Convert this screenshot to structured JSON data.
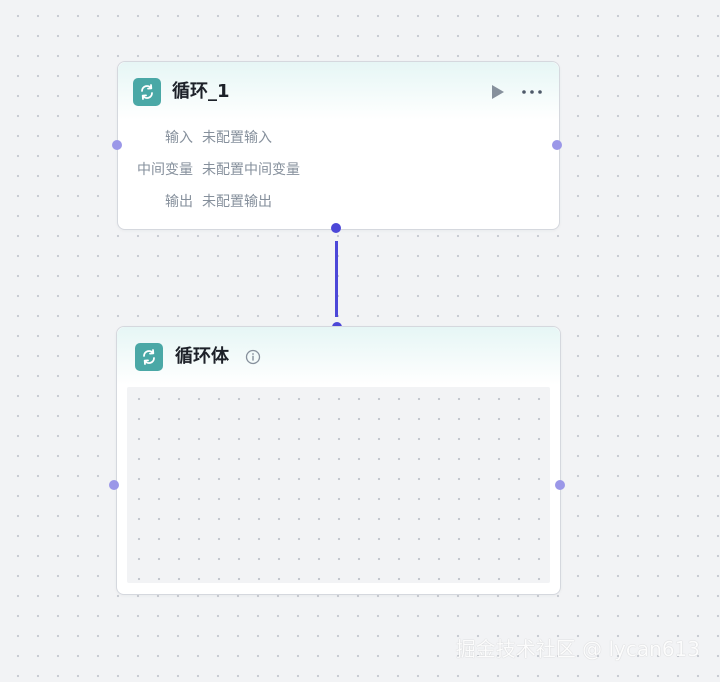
{
  "loop_node": {
    "icon": "loop-icon",
    "title": "循环_1",
    "run_icon": "play-icon",
    "more_icon": "more-horizontal-icon",
    "rows": [
      {
        "label": "输入",
        "value": "未配置输入"
      },
      {
        "label": "中间变量",
        "value": "未配置中间变量"
      },
      {
        "label": "输出",
        "value": "未配置输出"
      }
    ]
  },
  "loop_body_node": {
    "icon": "loop-icon",
    "title": "循环体",
    "info_icon": "info-icon"
  },
  "watermark": "掘金技术社区 @ lycan613",
  "colors": {
    "accent_teal": "#4aa8a6",
    "edge": "#4c47d8",
    "port": "#9b97e8",
    "canvas_bg": "#f2f3f5"
  }
}
